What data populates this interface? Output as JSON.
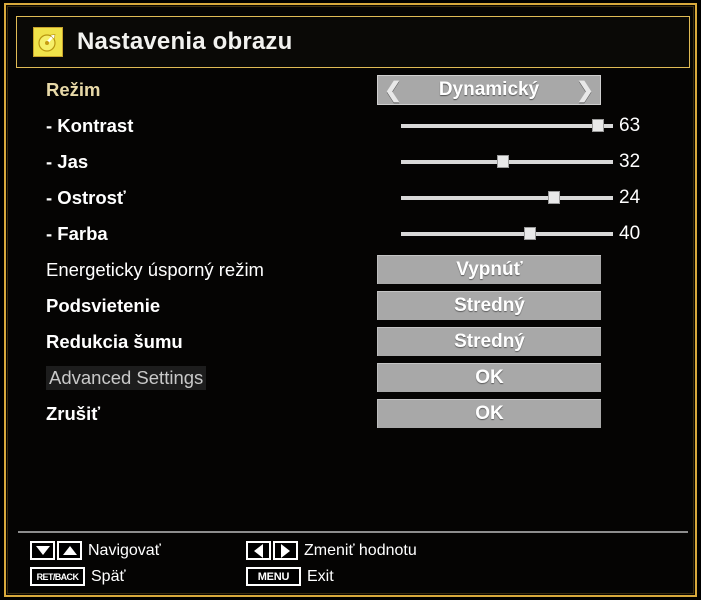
{
  "theme": {
    "frame_border": "#d8a93c",
    "background": "#000000",
    "selected_label": "#e8d9a8",
    "control_gray": "#a8a8a8",
    "text": "#ffffff"
  },
  "header": {
    "icon": "picture-settings-icon",
    "title": "Nastavenia obrazu"
  },
  "rows": [
    {
      "label": "Režim",
      "state": "selected",
      "control": "spinner",
      "value": "Dynamický",
      "prev_icon": "chevron-left-icon",
      "next_icon": "chevron-right-icon"
    },
    {
      "label": "- Kontrast",
      "state": "bold",
      "control": "slider",
      "value": "63",
      "knob_percent": 93
    },
    {
      "label": "- Jas",
      "state": "bold",
      "control": "slider",
      "value": "32",
      "knob_percent": 48
    },
    {
      "label": "- Ostrosť",
      "state": "bold",
      "control": "slider",
      "value": "24",
      "knob_percent": 72
    },
    {
      "label": "- Farba",
      "state": "bold",
      "control": "slider",
      "value": "40",
      "knob_percent": 61
    },
    {
      "label": "Energeticky úsporný režim",
      "state": "normal",
      "control": "button",
      "value": "Vypnúť"
    },
    {
      "label": "Podsvietenie",
      "state": "bold",
      "control": "button",
      "value": "Stredný"
    },
    {
      "label": "Redukcia šumu",
      "state": "bold",
      "control": "button",
      "value": "Stredný"
    },
    {
      "label": "Advanced Settings",
      "state": "dim",
      "control": "button",
      "value": "OK"
    },
    {
      "label": "Zrušiť",
      "state": "bold",
      "control": "button",
      "value": "OK"
    }
  ],
  "hints": {
    "left": [
      {
        "keys": [
          "arrow-down-icon",
          "arrow-up-icon"
        ],
        "text": "Navigovať"
      },
      {
        "keys": [
          "RET/BACK"
        ],
        "text": "Späť"
      }
    ],
    "right": [
      {
        "keys": [
          "arrow-left-icon",
          "arrow-right-icon"
        ],
        "text": "Zmeniť hodnotu"
      },
      {
        "keys": [
          "MENU"
        ],
        "text": "Exit"
      }
    ]
  }
}
